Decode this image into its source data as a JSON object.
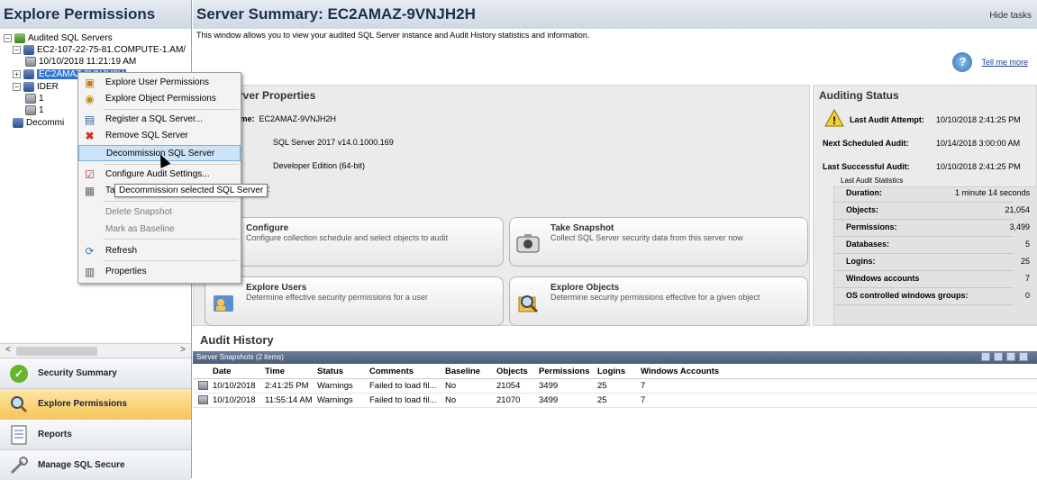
{
  "left": {
    "title": "Explore Permissions",
    "tree": [
      {
        "label": "Audited SQL Servers",
        "type": "root"
      },
      {
        "label": "EC2-107-22-75-81.COMPUTE-1.AM/",
        "type": "db"
      },
      {
        "label": "10/10/2018 11:21:19 AM",
        "type": "snap"
      },
      {
        "label": "EC2AMAZ-9VNJH2H",
        "type": "db"
      },
      {
        "label": "IDER",
        "type": "db"
      },
      {
        "label": "1",
        "type": "snap"
      },
      {
        "label": "1",
        "type": "snap"
      },
      {
        "label": "Decommi",
        "type": "db"
      }
    ],
    "scroll_left": "<",
    "scroll_right": ">"
  },
  "nav": [
    {
      "label": "Security Summary",
      "icon": "check-circle-icon"
    },
    {
      "label": "Explore Permissions",
      "icon": "magnifier-icon"
    },
    {
      "label": "Reports",
      "icon": "report-icon"
    },
    {
      "label": "Manage SQL Secure",
      "icon": "wrench-icon"
    }
  ],
  "header": {
    "title": "Server Summary: EC2AMAZ-9VNJH2H",
    "hide_tasks": "Hide tasks",
    "description": "This window allows you to view your audited SQL Server instance and Audit History statistics and information.",
    "tell_me_more": "Tell me more"
  },
  "properties": {
    "title": "rver Properties",
    "name_key": "Name:",
    "name_val": "EC2AMAZ-9VNJH2H",
    "version": "SQL Server 2017 v14.0.1000.169",
    "edition": "Developer Edition (64-bit)",
    "truncated": ":"
  },
  "tiles": [
    {
      "title": "Configure",
      "desc": "Configure collection schedule and select objects to audit"
    },
    {
      "title": "Take Snapshot",
      "desc": "Collect SQL Server security data from this server now"
    },
    {
      "title": "Explore Users",
      "desc": "Determine effective security permissions for a user"
    },
    {
      "title": "Explore Objects",
      "desc": "Determine security permissions effective for a given object"
    }
  ],
  "auditing_status": {
    "title": "Auditing Status",
    "last_attempt_key": "Last Audit Attempt:",
    "last_attempt_val": "10/10/2018 2:41:25 PM",
    "next_key": "Next Scheduled Audit:",
    "next_val": "10/14/2018 3:00:00 AM",
    "last_success_key": "Last Successful Audit:",
    "last_success_val": "10/10/2018 2:41:25 PM",
    "stats_label": "Last Audit Statistics",
    "stats": [
      {
        "key": "Duration:",
        "val": "1 minute 14 seconds"
      },
      {
        "key": "Objects:",
        "val": "21,054"
      },
      {
        "key": "Permissions:",
        "val": "3,499"
      },
      {
        "key": "Databases:",
        "val": "5"
      },
      {
        "key": "Logins:",
        "val": "25"
      },
      {
        "key": "Windows accounts",
        "val": "7"
      },
      {
        "key": "OS controlled windows groups:",
        "val": "0"
      }
    ]
  },
  "audit_history": {
    "title": "Audit History",
    "bar_label": "Server Snapshots (2 items)",
    "columns": [
      "Date",
      "Time",
      "Status",
      "Comments",
      "Baseline",
      "Objects",
      "Permissions",
      "Logins",
      "Windows Accounts"
    ],
    "rows": [
      [
        "10/10/2018",
        "2:41:25 PM",
        "Warnings",
        "Failed to load fil...",
        "No",
        "21054",
        "3499",
        "25",
        "7"
      ],
      [
        "10/10/2018",
        "11:55:14 AM",
        "Warnings",
        "Failed to load fil...",
        "No",
        "21070",
        "3499",
        "25",
        "7"
      ]
    ]
  },
  "context_menu": {
    "items": [
      {
        "label": "Explore User Permissions",
        "icon": "user-permissions-icon"
      },
      {
        "label": "Explore Object Permissions",
        "icon": "object-permissions-icon"
      },
      {
        "label": "Register a SQL Server...",
        "icon": "register-server-icon"
      },
      {
        "label": "Remove SQL Server",
        "icon": "remove-x-icon"
      },
      {
        "label": "Decommission SQL Server",
        "icon": ""
      },
      {
        "label": "Configure Audit Settings...",
        "icon": "configure-icon"
      },
      {
        "label": "Ta",
        "icon": "snapshot-icon"
      },
      {
        "label": "Delete Snapshot",
        "icon": ""
      },
      {
        "label": "Mark as Baseline",
        "icon": ""
      },
      {
        "label": "Refresh",
        "icon": "refresh-icon"
      },
      {
        "label": "Properties",
        "icon": "properties-icon"
      }
    ],
    "tooltip": "Decommission selected SQL Server"
  },
  "colors": {
    "header_bg": "#d6dfe9",
    "selection": "#3074d6",
    "menu_highlight": "#cde3f7",
    "grid_bar": "#56688a"
  }
}
